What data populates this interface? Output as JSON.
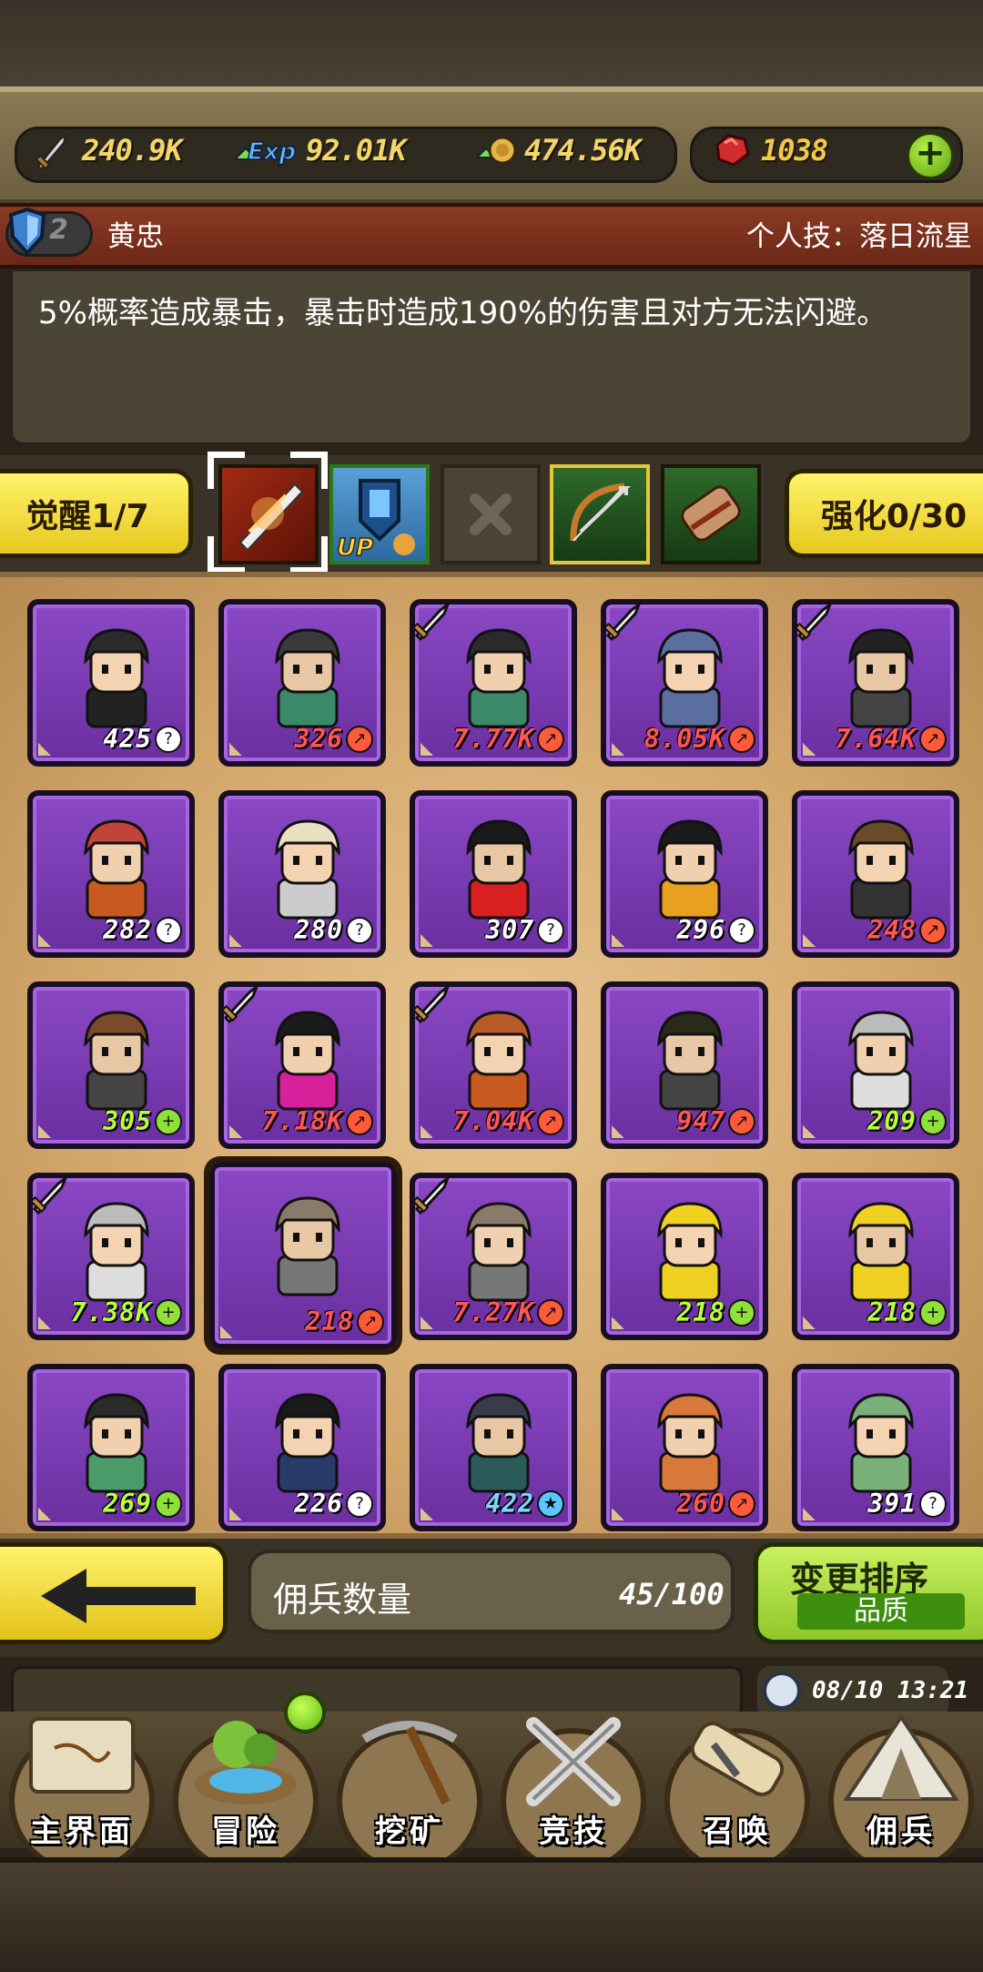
{
  "currencies": [
    {
      "name": "power",
      "icon": "sword-icon",
      "value": "240.9K"
    },
    {
      "name": "exp",
      "icon": "exp-icon",
      "value": "92.01K"
    },
    {
      "name": "gold",
      "icon": "coin-icon",
      "value": "474.56K"
    },
    {
      "name": "gem",
      "icon": "ruby-icon",
      "value": "1038"
    }
  ],
  "hero": {
    "rank": "2",
    "name": "黄忠",
    "skill_label": "个人技：落日流星",
    "description": "5%概率造成暴击，暴击时造成190%的伤害且对方无法闪避。"
  },
  "tabs": {
    "awaken": "觉醒1/7",
    "upgrade": "强化0/30"
  },
  "cards": [
    {
      "level": "425",
      "badge": "?",
      "color": "white",
      "sword": false
    },
    {
      "level": "326",
      "badge": "↗",
      "color": "red",
      "sword": false
    },
    {
      "level": "7.77K",
      "badge": "↗",
      "color": "red",
      "sword": true
    },
    {
      "level": "8.05K",
      "badge": "↗",
      "color": "red",
      "sword": true
    },
    {
      "level": "7.64K",
      "badge": "↗",
      "color": "red",
      "sword": true
    },
    {
      "level": "282",
      "badge": "?",
      "color": "white",
      "sword": false
    },
    {
      "level": "280",
      "badge": "?",
      "color": "white",
      "sword": false
    },
    {
      "level": "307",
      "badge": "?",
      "color": "white",
      "sword": false
    },
    {
      "level": "296",
      "badge": "?",
      "color": "white",
      "sword": false
    },
    {
      "level": "248",
      "badge": "↗",
      "color": "red",
      "sword": false
    },
    {
      "level": "305",
      "badge": "+",
      "color": "green",
      "sword": false
    },
    {
      "level": "7.18K",
      "badge": "↗",
      "color": "red",
      "sword": true
    },
    {
      "level": "7.04K",
      "badge": "↗",
      "color": "red",
      "sword": true
    },
    {
      "level": "947",
      "badge": "↗",
      "color": "red",
      "sword": false
    },
    {
      "level": "209",
      "badge": "+",
      "color": "green",
      "sword": false
    },
    {
      "level": "7.38K",
      "badge": "+",
      "color": "green",
      "sword": true
    },
    {
      "level": "218",
      "badge": "↗",
      "color": "red",
      "sword": false
    },
    {
      "level": "7.27K",
      "badge": "↗",
      "color": "red",
      "sword": true
    },
    {
      "level": "218",
      "badge": "+",
      "color": "green",
      "sword": false
    },
    {
      "level": "218",
      "badge": "+",
      "color": "green",
      "sword": false
    },
    {
      "level": "269",
      "badge": "+",
      "color": "green",
      "sword": false
    },
    {
      "level": "226",
      "badge": "?",
      "color": "white",
      "sword": false
    },
    {
      "level": "422",
      "badge": "★",
      "color": "blue",
      "sword": false
    },
    {
      "level": "260",
      "badge": "↗",
      "color": "red",
      "sword": false
    },
    {
      "level": "391",
      "badge": "?",
      "color": "white",
      "sword": false
    }
  ],
  "mercenary": {
    "count_label": "佣兵数量",
    "count_value": "45/100",
    "sort_title": "变更排序",
    "sort_sub": "品质"
  },
  "clock": "08/10 13:21",
  "nav": [
    "主界面",
    "冒险",
    "挖矿",
    "竞技",
    "召唤",
    "佣兵"
  ]
}
